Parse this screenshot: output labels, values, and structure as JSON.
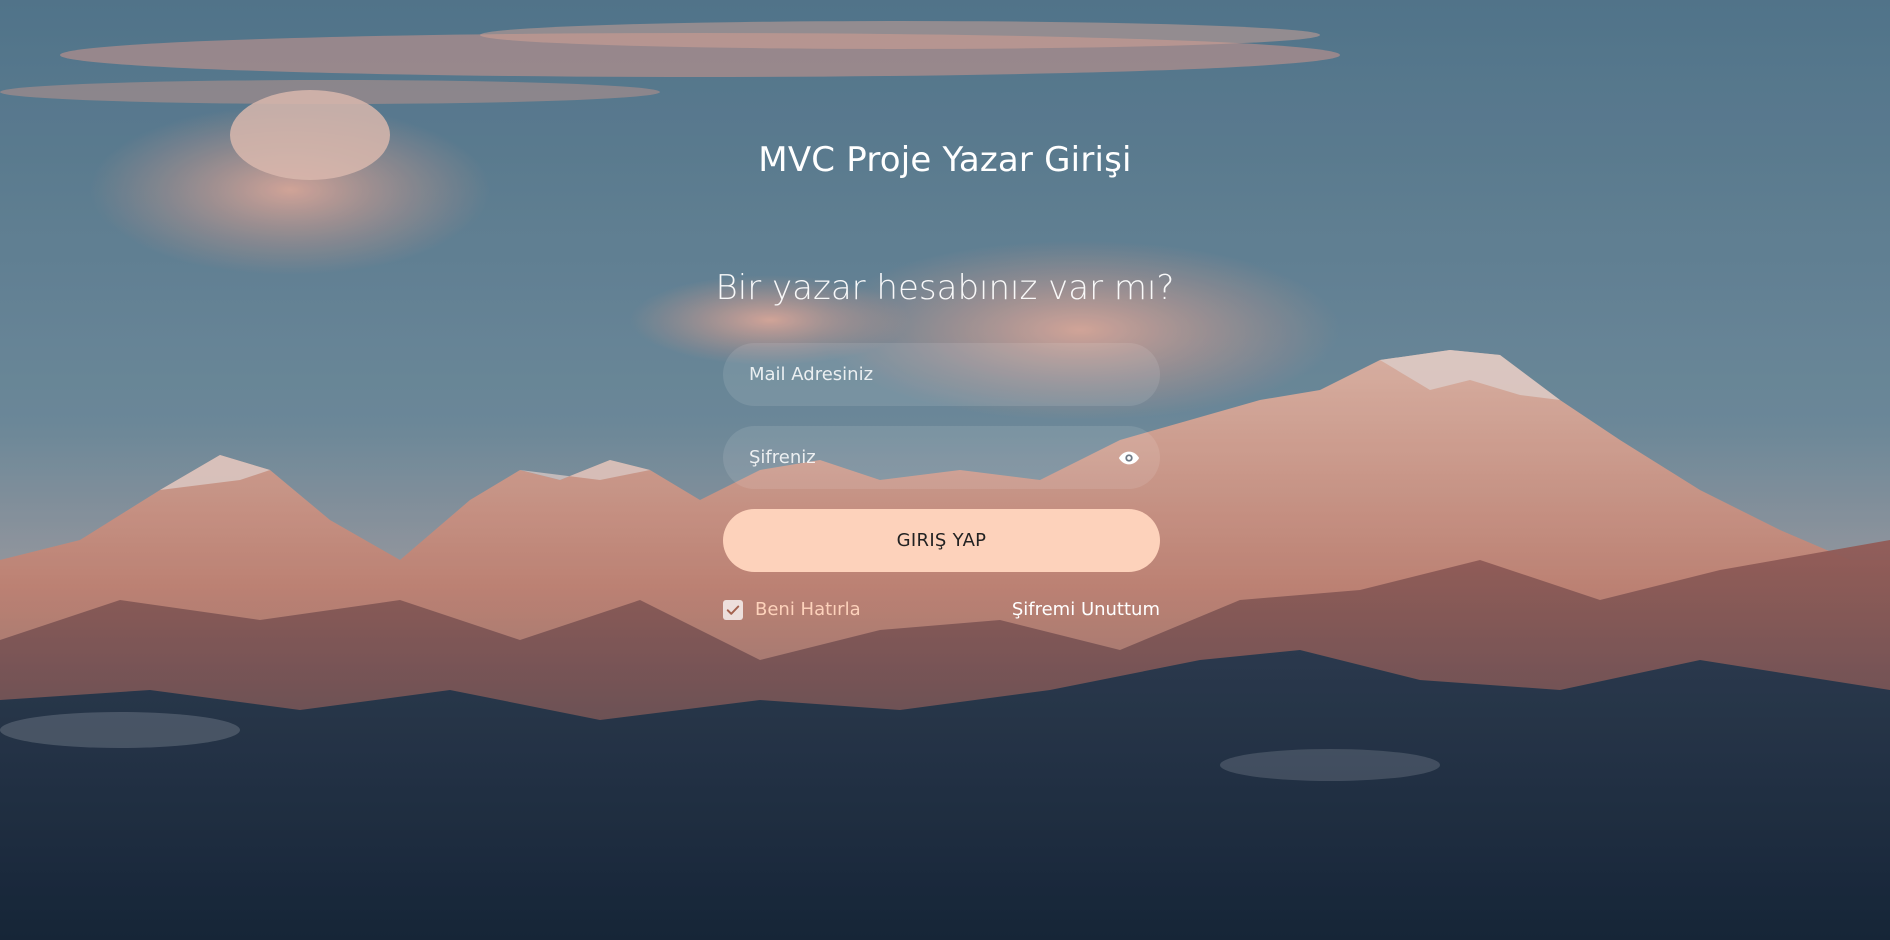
{
  "page": {
    "title": "MVC Proje Yazar Girişi",
    "subtitle": "Bir yazar hesabınız var mı?"
  },
  "form": {
    "email_placeholder": "Mail Adresiniz",
    "password_placeholder": "Şifreniz",
    "submit_label": "GIRIŞ YAP",
    "remember_label": "Beni Hatırla",
    "remember_checked": true,
    "forgot_label": "Şifremi Unuttum"
  },
  "icons": {
    "password_toggle": "eye-icon",
    "remember_check": "checkmark-icon"
  },
  "colors": {
    "accent": "#fdd2bb",
    "text": "#ffffff",
    "button_text": "#222222"
  }
}
